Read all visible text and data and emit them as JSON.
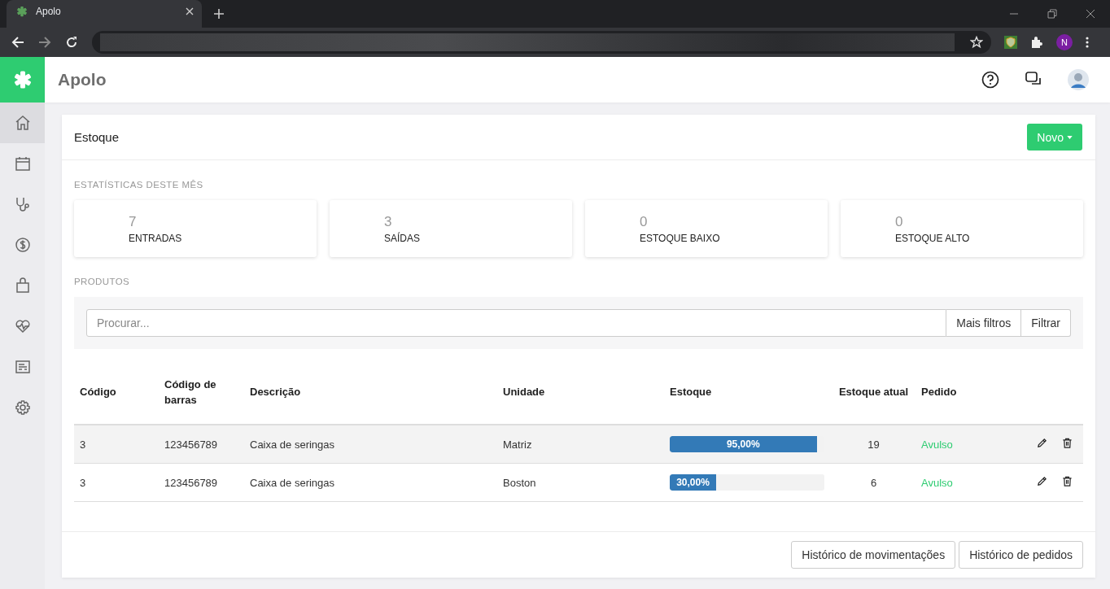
{
  "browser": {
    "tab_title": "Apolo",
    "profile_initial": "N"
  },
  "app": {
    "name": "Apolo"
  },
  "sidebar": {
    "items": [
      {
        "kind": "home",
        "selected": true
      },
      {
        "kind": "calendar",
        "selected": false
      },
      {
        "kind": "stethoscope",
        "selected": false
      },
      {
        "kind": "dollar",
        "selected": false
      },
      {
        "kind": "bag",
        "selected": false
      },
      {
        "kind": "heart",
        "selected": false
      },
      {
        "kind": "list",
        "selected": false
      },
      {
        "kind": "gear",
        "selected": false
      }
    ]
  },
  "page": {
    "title": "Estoque",
    "new_button": "Novo"
  },
  "stats": {
    "heading": "ESTATÍSTICAS DESTE MÊS",
    "cards": [
      {
        "value": "7",
        "label": "ENTRADAS"
      },
      {
        "value": "3",
        "label": "SAÍDAS"
      },
      {
        "value": "0",
        "label": "ESTOQUE BAIXO"
      },
      {
        "value": "0",
        "label": "ESTOQUE ALTO"
      }
    ]
  },
  "products": {
    "heading": "PRODUTOS",
    "search": {
      "placeholder": "Procurar..."
    },
    "more_filters": "Mais filtros",
    "filter": "Filtrar"
  },
  "table": {
    "columns": [
      "Código",
      "Código de barras",
      "Descrição",
      "Unidade",
      "Estoque",
      "Estoque atual",
      "Pedido"
    ],
    "rows": [
      {
        "code": "3",
        "barcode": "123456789",
        "description": "Caixa de seringas",
        "unit": "Matriz",
        "level": 0.95,
        "percent": "95,00%",
        "current": "19",
        "order": "Avulso",
        "hovered": true
      },
      {
        "code": "3",
        "barcode": "123456789",
        "description": "Caixa de seringas",
        "unit": "Boston",
        "level": 0.3,
        "percent": "30,00%",
        "current": "6",
        "order": "Avulso",
        "hovered": false
      }
    ]
  },
  "footer_buttons": [
    "Histórico de movimentações",
    "Histórico de pedidos"
  ]
}
